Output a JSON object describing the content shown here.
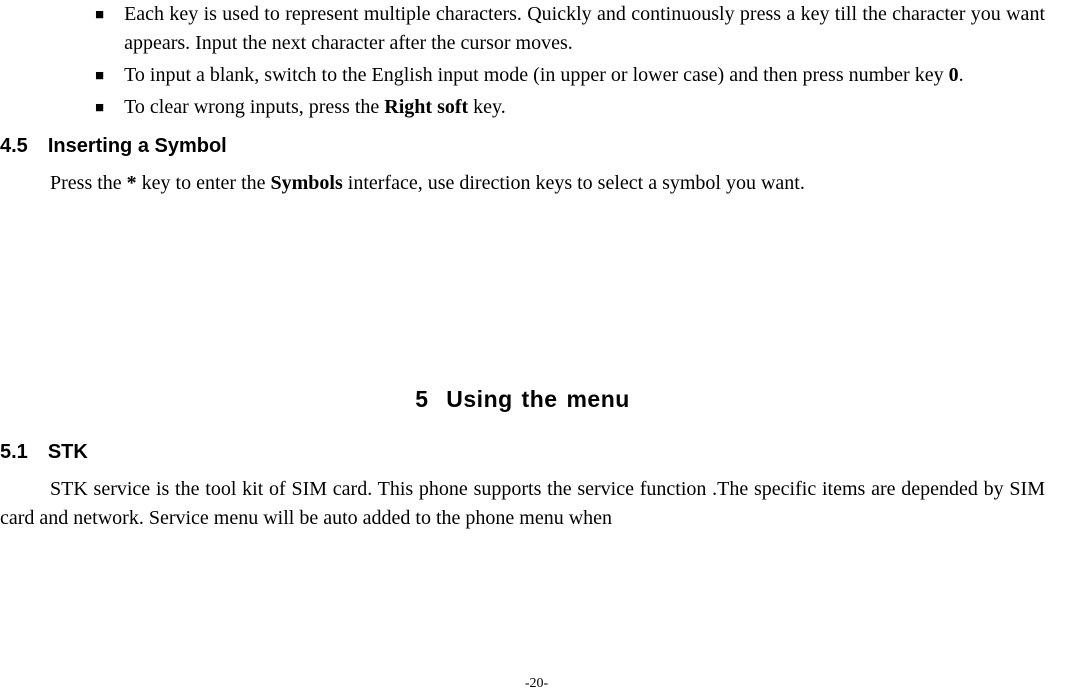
{
  "bullets": [
    {
      "textParts": [
        {
          "t": "Each key is used to represent multiple characters. Quickly and continuously press a key till the character you want appears. Input the next character after the cursor moves.",
          "b": false
        }
      ]
    },
    {
      "textParts": [
        {
          "t": "To input a blank, switch to the English input mode (in upper or lower case) and then press number key ",
          "b": false
        },
        {
          "t": "0",
          "b": true
        },
        {
          "t": ".",
          "b": false
        }
      ]
    },
    {
      "textParts": [
        {
          "t": "To clear wrong inputs, press the ",
          "b": false
        },
        {
          "t": "Right soft",
          "b": true
        },
        {
          "t": " key.",
          "b": false
        }
      ]
    }
  ],
  "section45": {
    "num": "4.5",
    "title": "Inserting a Symbol"
  },
  "section45Para": {
    "parts": [
      {
        "t": "Press the ",
        "b": false
      },
      {
        "t": "*",
        "b": true
      },
      {
        "t": " key to enter the ",
        "b": false
      },
      {
        "t": "Symbols",
        "b": true
      },
      {
        "t": " interface, use direction keys to select a symbol you want.",
        "b": false
      }
    ]
  },
  "chapter5": {
    "num": "5",
    "title": "Using the menu"
  },
  "section51": {
    "num": "5.1",
    "title": "STK"
  },
  "section51Para": "STK service is the tool kit of SIM card. This phone supports the service function .The specific items are depended by SIM card and network. Service menu will be auto added to the phone menu when",
  "pageNumber": "-20-"
}
